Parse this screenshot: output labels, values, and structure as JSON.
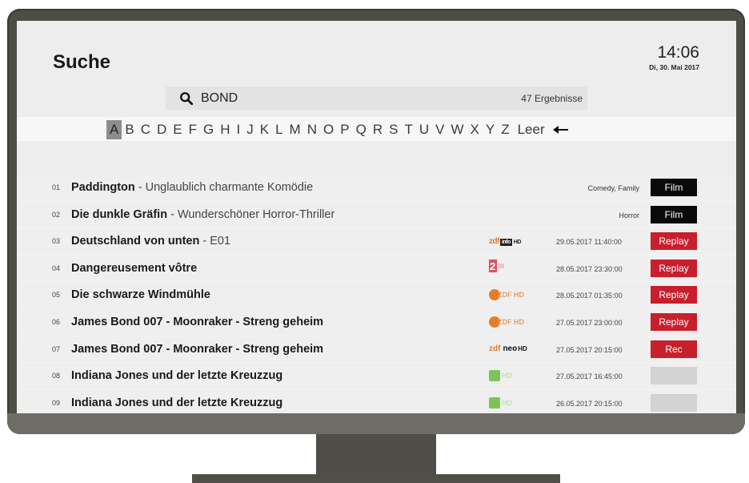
{
  "page": {
    "title": "Suche"
  },
  "clock": {
    "time": "14:06",
    "date": "Di, 30. Mai 2017"
  },
  "search": {
    "query": "BOND",
    "result_count": "47 Ergebnisse"
  },
  "keyboard": {
    "keys": [
      "A",
      "B",
      "C",
      "D",
      "E",
      "F",
      "G",
      "H",
      "I",
      "J",
      "K",
      "L",
      "M",
      "N",
      "O",
      "P",
      "Q",
      "R",
      "S",
      "T",
      "U",
      "V",
      "W",
      "X",
      "Y",
      "Z",
      "Leer"
    ],
    "selected": "A",
    "backspace_icon": "arrow-left-icon"
  },
  "results": [
    {
      "num": "01",
      "title": "Paddington",
      "subtitle": " - Unglaublich charmante Komödie",
      "genre": "Comedy, Family",
      "channel": "",
      "datetime": "",
      "action": "Film"
    },
    {
      "num": "02",
      "title": "Die dunkle Gräfin",
      "subtitle": " - Wunderschöner Horror-Thriller",
      "genre": "Horror",
      "channel": "",
      "datetime": "",
      "action": "Film"
    },
    {
      "num": "03",
      "title": "Deutschland von unten",
      "subtitle": " - E01",
      "genre": "",
      "channel": "zdfinfo",
      "datetime": "29.05.2017 11:40:00",
      "action": "Replay"
    },
    {
      "num": "04",
      "title": "Dangereusement vôtre",
      "subtitle": "",
      "genre": "",
      "channel": "zdf2",
      "datetime": "28.05.2017 23:30:00",
      "action": "Replay"
    },
    {
      "num": "05",
      "title": "Die schwarze Windmühle",
      "subtitle": "",
      "genre": "",
      "channel": "zdfhd",
      "datetime": "28.05.2017 01:35:00",
      "action": "Replay"
    },
    {
      "num": "06",
      "title": "James Bond 007 - Moonraker - Streng geheim",
      "subtitle": "",
      "genre": "",
      "channel": "zdfhd",
      "datetime": "27.05.2017 23:00:00",
      "action": "Replay"
    },
    {
      "num": "07",
      "title": "James Bond 007 - Moonraker - Streng geheim",
      "subtitle": "",
      "genre": "",
      "channel": "zdfneo",
      "datetime": "27.05.2017 20:15:00",
      "action": "Rec"
    },
    {
      "num": "08",
      "title": "Indiana Jones und der letzte Kreuzzug",
      "subtitle": "",
      "genre": "",
      "channel": "kika",
      "datetime": "27.05.2017 16:45:00",
      "action": ""
    },
    {
      "num": "09",
      "title": "Indiana Jones und der letzte Kreuzzug",
      "subtitle": "",
      "genre": "",
      "channel": "kika",
      "datetime": "26.05.2017 20:15:00",
      "action": ""
    }
  ],
  "channel_logos": {
    "zdfinfo": {
      "prefix": "zdf",
      "box": "info",
      "suffix": "HD"
    },
    "zdfneo": {
      "prefix": "zdf",
      "word": "neo",
      "suffix": "HD"
    },
    "zdfhd": {
      "text": "ZDF HD"
    },
    "kika": {
      "text": "HD"
    }
  },
  "colors": {
    "replay": "#c81f2d",
    "film": "#0a0a0a",
    "zdf_orange": "#e37d2c",
    "kika_green": "#7ec357"
  }
}
